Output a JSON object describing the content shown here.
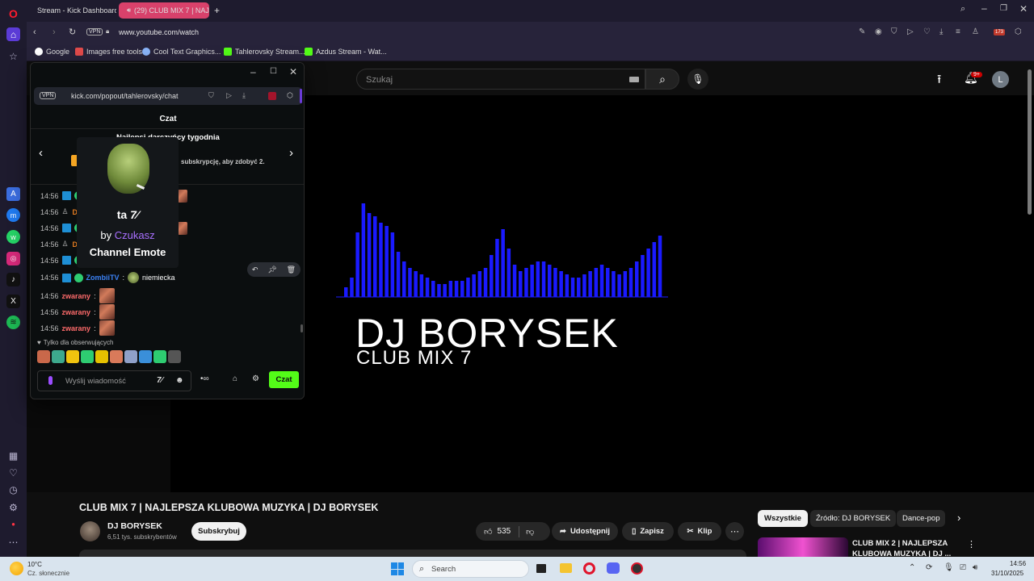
{
  "tabs": [
    {
      "label": "Stream - Kick Dashboard"
    },
    {
      "label": "(29) CLUB MIX 7 | NAJ..."
    }
  ],
  "address": {
    "url": "www.youtube.com/watch",
    "vpn": "VPN"
  },
  "bookmarks": [
    {
      "label": "Google"
    },
    {
      "label": "Images free tools"
    },
    {
      "label": "Cool Text Graphics..."
    },
    {
      "label": "Tahlerovsky Stream..."
    },
    {
      "label": "Azdus Stream - Wat..."
    }
  ],
  "badges": {
    "extension_count": "173",
    "notifications": "9+",
    "avatar_letter": "L"
  },
  "yt": {
    "search_placeholder": "Szukaj",
    "video_title": "CLUB MIX 7 | NAJLEPSZA KLUBOWA MUZYKA | DJ BORYSEK",
    "channel_name": "DJ BORYSEK",
    "subscribers": "6,51 tys. subskrybentów",
    "subscribe_label": "Subskrybuj",
    "likes": "535",
    "share_label": "Udostępnij",
    "save_label": "Zapisz",
    "clip_label": "Klip",
    "chips": [
      "Wszystkie",
      "Źródło: DJ BORYSEK",
      "Dance-pop"
    ],
    "rec_title_1": "CLUB MIX 2 | NAJLEPSZA",
    "rec_title_2": "KLUBOWA MUZYKA | DJ ..."
  },
  "player": {
    "title_big": "DJ BORYSEK",
    "subtitle": "CLUB MIX 7"
  },
  "popup": {
    "url": "kick.com/popout/tahlerovsky/chat",
    "vpn": "VPN",
    "header": "Czat",
    "gifters_title": "Najlepsi darczyńcy tygodnia",
    "gifters_sub": "subskrypcję, aby zdobyć 2.",
    "tooltip_name": "ta",
    "tooltip_by": "by",
    "tooltip_author": "Czukasz",
    "tooltip_type": "Channel Emote",
    "followers_only": "Tylko dla obserwujących",
    "input_placeholder": "Wyślij wiadomość",
    "send_label": "Czat"
  },
  "chat": [
    {
      "time": "14:56",
      "user": "",
      "msg": ""
    },
    {
      "time": "14:56",
      "user": "D",
      "msg": ""
    },
    {
      "time": "14:56",
      "user": "",
      "msg": ""
    },
    {
      "time": "14:56",
      "user": "D",
      "msg": ""
    },
    {
      "time": "14:56",
      "user": "",
      "msg": ""
    },
    {
      "time": "14:56",
      "user": "ZombiiTV",
      "msg": "niemiecka"
    },
    {
      "time": "14:56",
      "user": "zwarany",
      "msg": ""
    },
    {
      "time": "14:56",
      "user": "zwarany",
      "msg": ""
    },
    {
      "time": "14:56",
      "user": "zwarany",
      "msg": ""
    }
  ],
  "taskbar": {
    "temp": "10°C",
    "weather": "Cz. słonecznie",
    "search": "Search",
    "time": "14:56",
    "date": "31/10/2025"
  },
  "visualizer": [
    6,
    12,
    40,
    58,
    52,
    50,
    46,
    44,
    40,
    28,
    22,
    18,
    16,
    14,
    12,
    10,
    8,
    8,
    10,
    10,
    10,
    12,
    14,
    16,
    18,
    26,
    36,
    42,
    30,
    20,
    16,
    18,
    20,
    22,
    22,
    20,
    18,
    16,
    14,
    12,
    12,
    14,
    16,
    18,
    20,
    18,
    16,
    14,
    16,
    18,
    22,
    26,
    30,
    34,
    38
  ],
  "colors": {
    "kick_green": "#53fc18",
    "visualizer": "#1a1aff",
    "tooltip_author": "#a970ff"
  }
}
